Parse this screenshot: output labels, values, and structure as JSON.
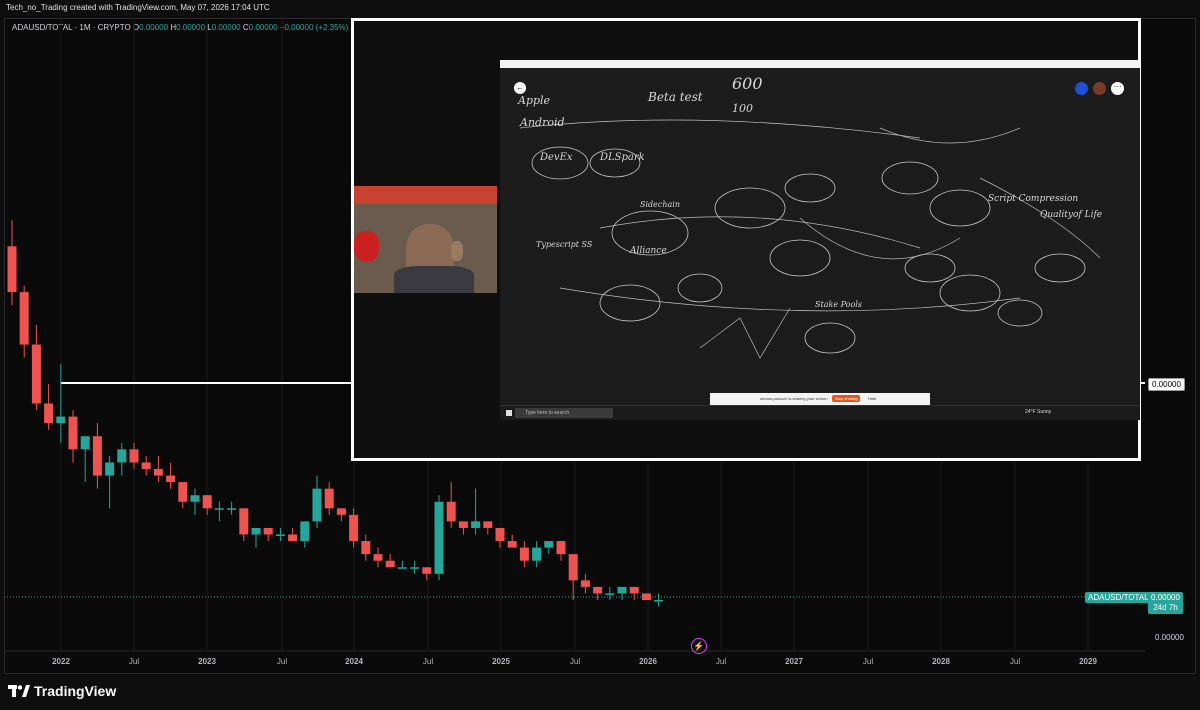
{
  "header": {
    "credit": "Tech_no_Trading created with TradingView.com, May 07, 2026 17:04 UTC"
  },
  "legend": {
    "symbol": "ADAUSD/TOTAL · 1M · CRYPTO",
    "o_label": "O",
    "o_val": "0.00000",
    "h_label": "H",
    "h_val": "0.00000",
    "l_label": "L",
    "l_val": "0.00000",
    "c_label": "C",
    "c_val": "0.00000",
    "change": "+0.00000 (+2.35%)"
  },
  "price_tags": {
    "upper": "0.00000",
    "symbol_tag": "ADAUSD/TOTAL",
    "current": "0.00000",
    "countdown": "24d 7h",
    "axis_bottom": "0.00000"
  },
  "overlay": {
    "whiteboard_words": [
      "600",
      "Beta test",
      "100",
      "Apple",
      "Android",
      "DevEx",
      "DLSpark",
      "Sidechain",
      "Script Compression",
      "Qualityof Life",
      "Alliance",
      "Stake Pools",
      "Typescript SS"
    ],
    "taskbar_search": "Type here to search",
    "share_text": "stream.pancoin is sharing your screen",
    "stop_sharing": "Stop sharing",
    "hide": "Hide",
    "weather": "24°F Sunny"
  },
  "chart_data": {
    "type": "candlestick",
    "symbol": "ADAUSD/TOTAL",
    "interval": "1M",
    "x_labels": [
      "2022",
      "Jul",
      "2023",
      "Jul",
      "2024",
      "Jul",
      "2025",
      "Jul",
      "2026",
      "Jul",
      "2027",
      "Jul",
      "2028",
      "Jul",
      "2029"
    ],
    "y_axis_labels": [
      "0.00000",
      "0.00000"
    ],
    "up_color": "#26a69a",
    "down_color": "#ef5350",
    "candles": [
      {
        "o": 78,
        "h": 82,
        "l": 69,
        "c": 71
      },
      {
        "o": 71,
        "h": 72,
        "l": 61,
        "c": 63
      },
      {
        "o": 63,
        "h": 66,
        "l": 53,
        "c": 54
      },
      {
        "o": 54,
        "h": 57,
        "l": 50,
        "c": 51
      },
      {
        "o": 51,
        "h": 60,
        "l": 48,
        "c": 52
      },
      {
        "o": 52,
        "h": 53,
        "l": 45,
        "c": 47
      },
      {
        "o": 47,
        "h": 49,
        "l": 42,
        "c": 49
      },
      {
        "o": 49,
        "h": 51,
        "l": 41,
        "c": 43
      },
      {
        "o": 43,
        "h": 46,
        "l": 38,
        "c": 45
      },
      {
        "o": 45,
        "h": 48,
        "l": 43,
        "c": 47
      },
      {
        "o": 47,
        "h": 48,
        "l": 44,
        "c": 45
      },
      {
        "o": 45,
        "h": 46,
        "l": 43,
        "c": 44
      },
      {
        "o": 44,
        "h": 46,
        "l": 42,
        "c": 43
      },
      {
        "o": 43,
        "h": 45,
        "l": 41,
        "c": 42
      },
      {
        "o": 42,
        "h": 42,
        "l": 38,
        "c": 39
      },
      {
        "o": 39,
        "h": 41,
        "l": 37,
        "c": 40
      },
      {
        "o": 40,
        "h": 40,
        "l": 37,
        "c": 38
      },
      {
        "o": 38,
        "h": 39,
        "l": 36,
        "c": 38
      },
      {
        "o": 38,
        "h": 39,
        "l": 37,
        "c": 38
      },
      {
        "o": 38,
        "h": 38,
        "l": 33,
        "c": 34
      },
      {
        "o": 34,
        "h": 35,
        "l": 32,
        "c": 35
      },
      {
        "o": 35,
        "h": 35,
        "l": 33,
        "c": 34
      },
      {
        "o": 34,
        "h": 35,
        "l": 33,
        "c": 34
      },
      {
        "o": 34,
        "h": 35,
        "l": 33,
        "c": 33
      },
      {
        "o": 33,
        "h": 36,
        "l": 32,
        "c": 36
      },
      {
        "o": 36,
        "h": 43,
        "l": 35,
        "c": 41
      },
      {
        "o": 41,
        "h": 42,
        "l": 37,
        "c": 38
      },
      {
        "o": 38,
        "h": 38,
        "l": 36,
        "c": 37
      },
      {
        "o": 37,
        "h": 38,
        "l": 32,
        "c": 33
      },
      {
        "o": 33,
        "h": 34,
        "l": 30,
        "c": 31
      },
      {
        "o": 31,
        "h": 32,
        "l": 29,
        "c": 30
      },
      {
        "o": 30,
        "h": 31,
        "l": 29,
        "c": 29
      },
      {
        "o": 29,
        "h": 30,
        "l": 29,
        "c": 29
      },
      {
        "o": 29,
        "h": 30,
        "l": 28,
        "c": 29
      },
      {
        "o": 29,
        "h": 29,
        "l": 27,
        "c": 28
      },
      {
        "o": 28,
        "h": 40,
        "l": 27,
        "c": 39
      },
      {
        "o": 39,
        "h": 42,
        "l": 35,
        "c": 36
      },
      {
        "o": 36,
        "h": 36,
        "l": 34,
        "c": 35
      },
      {
        "o": 35,
        "h": 41,
        "l": 34,
        "c": 36
      },
      {
        "o": 36,
        "h": 36,
        "l": 34,
        "c": 35
      },
      {
        "o": 35,
        "h": 35,
        "l": 32,
        "c": 33
      },
      {
        "o": 33,
        "h": 34,
        "l": 32,
        "c": 32
      },
      {
        "o": 32,
        "h": 33,
        "l": 29,
        "c": 30
      },
      {
        "o": 30,
        "h": 33,
        "l": 29,
        "c": 32
      },
      {
        "o": 32,
        "h": 33,
        "l": 31,
        "c": 33
      },
      {
        "o": 33,
        "h": 33,
        "l": 30,
        "c": 31
      },
      {
        "o": 31,
        "h": 31,
        "l": 24,
        "c": 27
      },
      {
        "o": 27,
        "h": 28,
        "l": 25,
        "c": 26
      },
      {
        "o": 26,
        "h": 26,
        "l": 24,
        "c": 25
      },
      {
        "o": 25,
        "h": 26,
        "l": 24,
        "c": 25
      },
      {
        "o": 25,
        "h": 26,
        "l": 24,
        "c": 26
      },
      {
        "o": 26,
        "h": 26,
        "l": 24,
        "c": 25
      },
      {
        "o": 25,
        "h": 25,
        "l": 24,
        "c": 24
      },
      {
        "o": 24,
        "h": 25,
        "l": 23,
        "c": 24
      }
    ]
  }
}
